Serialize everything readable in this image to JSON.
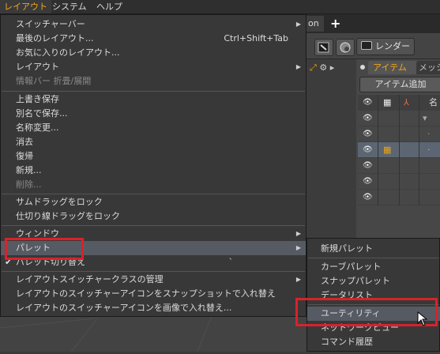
{
  "menubar": {
    "items": [
      {
        "label": "レイアウト",
        "active": true
      },
      {
        "label": "システム",
        "active": false
      },
      {
        "label": "ヘルプ",
        "active": false
      }
    ]
  },
  "background": {
    "tab_partial": "on",
    "plus": "+",
    "render_button": "レンダー",
    "panel_tabs": {
      "active": "アイテム",
      "inactive": "メッシ"
    },
    "add_item_button": "アイテム追加",
    "name_header": "名"
  },
  "layout_menu": {
    "group1": [
      {
        "label": "スイッチャーバー",
        "submenu": true
      },
      {
        "label": "最後のレイアウト...",
        "shortcut": "Ctrl+Shift+Tab"
      },
      {
        "label": "お気に入りのレイアウト..."
      },
      {
        "label": "レイアウト",
        "submenu": true
      },
      {
        "label": "情報バー 折畳/展開",
        "disabled": true
      }
    ],
    "group2": [
      {
        "label": "上書き保存"
      },
      {
        "label": "別名で保存..."
      },
      {
        "label": "名称変更..."
      },
      {
        "label": "消去"
      },
      {
        "label": "復帰"
      },
      {
        "label": "新規..."
      },
      {
        "label": "削除...",
        "disabled": true
      }
    ],
    "group3": [
      {
        "label": "サムドラッグをロック"
      },
      {
        "label": "仕切り線ドラッグをロック"
      }
    ],
    "group4": [
      {
        "label": "ウィンドウ",
        "submenu": true
      },
      {
        "label": "パレット",
        "submenu": true,
        "highlighted": true
      },
      {
        "label": "パレット切り替え",
        "checked": true,
        "shortcut": "`"
      }
    ],
    "group5": [
      {
        "label": "レイアウトスイッチャークラスの管理",
        "submenu": true
      },
      {
        "label": "レイアウトのスイッチャーアイコンをスナップショットで入れ替え"
      },
      {
        "label": "レイアウトのスイッチャーアイコンを画像で入れ替え..."
      }
    ]
  },
  "palette_submenu": {
    "items": [
      {
        "label": "新規パレット"
      },
      {
        "label": "カーブパレット"
      },
      {
        "label": "スナップパレット"
      },
      {
        "label": "データリスト"
      },
      {
        "label": "ユーティリティ",
        "highlighted": true
      },
      {
        "label": "ネットワークビュー"
      },
      {
        "label": "コマンド履歴"
      }
    ]
  },
  "colors": {
    "active_menu_text": "#f1a71c",
    "highlight_row": "#565b63",
    "annotation_box": "#d7232b"
  }
}
